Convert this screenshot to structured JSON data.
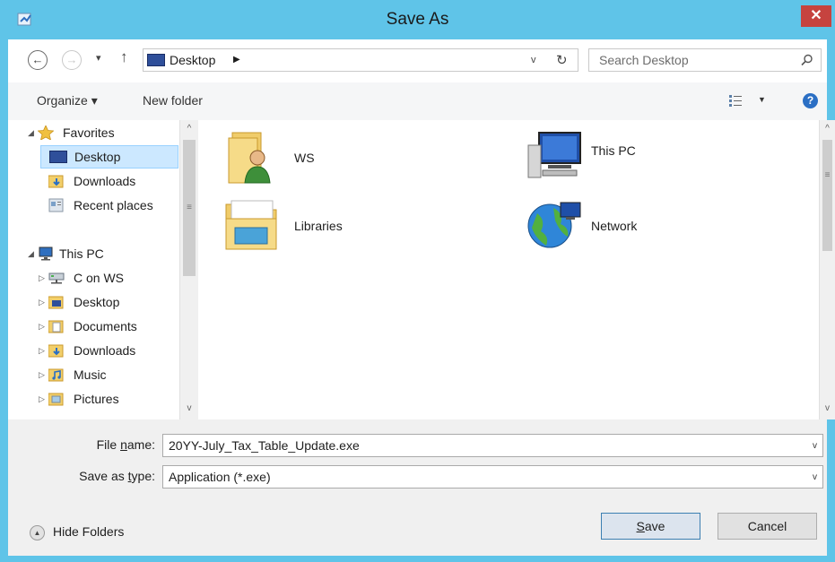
{
  "window": {
    "title": "Save As"
  },
  "nav": {
    "back_glyph": "←",
    "forward_glyph": "→",
    "dropdown_glyph": "▾",
    "up_glyph": "↑"
  },
  "address": {
    "path": "Desktop",
    "arrow": "▶",
    "dropdown": "v",
    "refresh": "↻"
  },
  "search": {
    "placeholder": "Search Desktop"
  },
  "toolbar": {
    "organize": "Organize ▾",
    "new_folder": "New folder",
    "view_dd": "▼",
    "help": "?"
  },
  "tree": [
    {
      "label": "Favorites",
      "expander": "◢",
      "icon": "star-icon",
      "selected": false
    },
    {
      "label": "Desktop",
      "expander": "",
      "icon": "desktop-icon",
      "selected": true
    },
    {
      "label": "Downloads",
      "expander": "",
      "icon": "downloads-folder-icon",
      "selected": false
    },
    {
      "label": "Recent places",
      "expander": "",
      "icon": "recent-places-icon",
      "selected": false
    },
    {
      "label": "This PC",
      "expander": "◢",
      "icon": "computer-icon",
      "selected": false
    },
    {
      "label": "C on WS",
      "expander": "▷",
      "icon": "network-drive-icon",
      "selected": false
    },
    {
      "label": "Desktop",
      "expander": "▷",
      "icon": "desktop-folder-icon",
      "selected": false
    },
    {
      "label": "Documents",
      "expander": "▷",
      "icon": "documents-folder-icon",
      "selected": false
    },
    {
      "label": "Downloads",
      "expander": "▷",
      "icon": "downloads-folder-icon",
      "selected": false
    },
    {
      "label": "Music",
      "expander": "▷",
      "icon": "music-folder-icon",
      "selected": false
    },
    {
      "label": "Pictures",
      "expander": "▷",
      "icon": "pictures-folder-icon",
      "selected": false
    }
  ],
  "content": [
    {
      "label": "WS",
      "icon": "user-folder-icon"
    },
    {
      "label": "This PC",
      "icon": "computer-icon"
    },
    {
      "label": "Libraries",
      "icon": "libraries-icon"
    },
    {
      "label": "Network",
      "icon": "network-globe-icon"
    }
  ],
  "scrollbar": {
    "up": "^",
    "down": "v",
    "grip": "≡"
  },
  "file_name": {
    "label_pre": "File ",
    "label_u": "n",
    "label_post": "ame:",
    "value": "20YY-July_Tax_Table_Update.exe",
    "dd": "v"
  },
  "save_type": {
    "label_pre": "Save as ",
    "label_u": "t",
    "label_post": "ype:",
    "value": "Application (*.exe)",
    "dd": "v"
  },
  "hide_folders": {
    "label": "Hide Folders",
    "glyph": "▲"
  },
  "buttons": {
    "save_u": "S",
    "save_rest": "ave",
    "cancel": "Cancel"
  },
  "colors": {
    "titlebar": "#5fc4e8",
    "close": "#c6433f",
    "selection": "#cce8ff",
    "accent": "#2b6fc4"
  }
}
